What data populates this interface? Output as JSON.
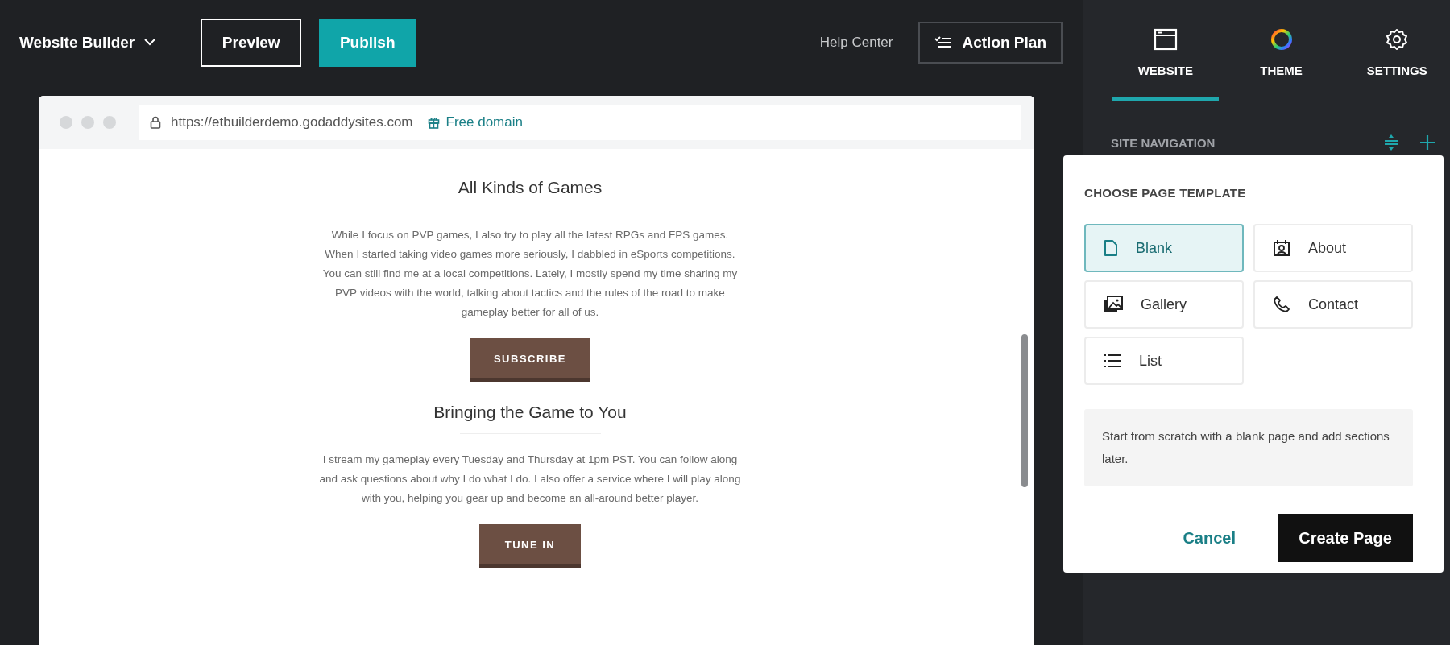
{
  "topbar": {
    "app_menu": "Website Builder",
    "preview": "Preview",
    "publish": "Publish",
    "help": "Help Center",
    "action_plan": "Action Plan"
  },
  "browser": {
    "url": "https://etbuilderdemo.godaddysites.com",
    "domain_link": "Free domain",
    "sections": [
      {
        "heading": "All Kinds of Games",
        "text": "While I focus on PVP games, I also try to play all the latest RPGs and FPS games. When I started taking video games more seriously, I dabbled in eSports competitions. You can still find me at a local competitions. Lately, I mostly spend my time sharing my PVP videos with the world, talking about tactics and the rules of the road to make gameplay better for all of us.",
        "button": "SUBSCRIBE"
      },
      {
        "heading": "Bringing the Game to You",
        "text": "I stream my gameplay every Tuesday and Thursday at 1pm PST. You can follow along and ask questions about why I do what I do. I also offer a service where I will play along with you, helping you gear up and become an all-around better player.",
        "button": "TUNE IN"
      }
    ]
  },
  "tabs": [
    {
      "label": "WEBSITE",
      "kind": "website",
      "selected": true
    },
    {
      "label": "THEME",
      "kind": "theme",
      "selected": false
    },
    {
      "label": "SETTINGS",
      "kind": "settings",
      "selected": false
    }
  ],
  "site_navigation": {
    "title": "SITE NAVIGATION"
  },
  "dialog": {
    "title": "CHOOSE PAGE TEMPLATE",
    "templates": [
      {
        "label": "Blank",
        "kind": "blank",
        "selected": true
      },
      {
        "label": "About",
        "kind": "about",
        "selected": false
      },
      {
        "label": "Gallery",
        "kind": "gallery",
        "selected": false
      },
      {
        "label": "Contact",
        "kind": "contact",
        "selected": false
      },
      {
        "label": "List",
        "kind": "list",
        "selected": false
      }
    ],
    "description": "Start from scratch with a blank page and add sections later.",
    "cancel": "Cancel",
    "create": "Create Page"
  }
}
